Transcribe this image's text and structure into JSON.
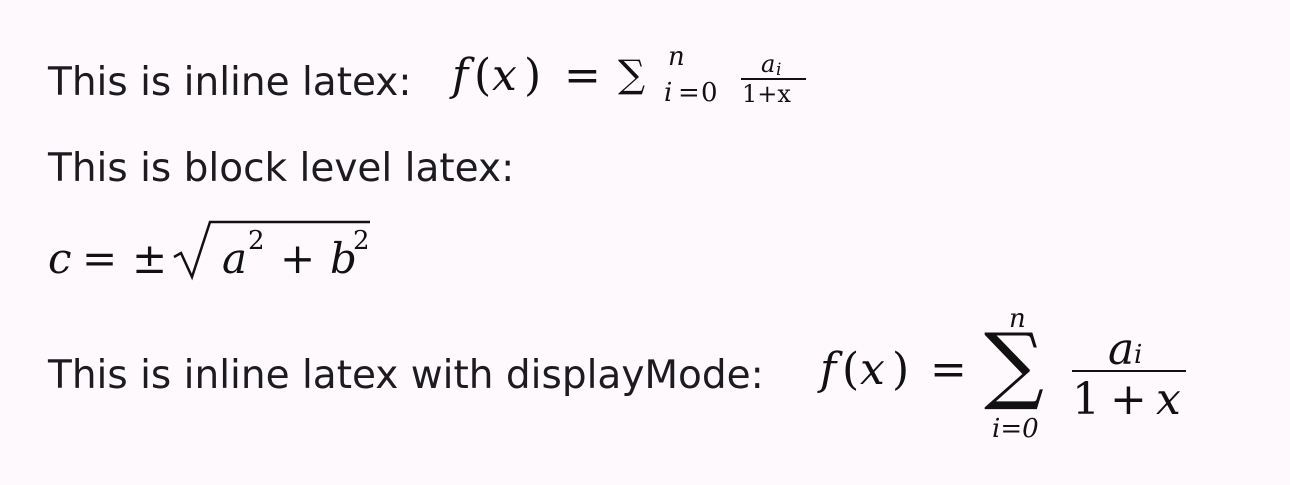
{
  "lines": {
    "inline_label": "This is inline latex:",
    "block_label": "This is block level latex:",
    "display_label": "This is inline latex with displayMode:"
  },
  "inline_math": {
    "f": "f",
    "lparen": "(",
    "x": "x",
    "rparen": ")",
    "eq": "=",
    "sum": "∑",
    "sup": "n",
    "sub_i": "i",
    "sub_eq": "=",
    "sub_0": "0",
    "num_a": "a",
    "num_i": "i",
    "den": "1+x"
  },
  "block_math": {
    "c": "c",
    "eq": "=",
    "pm": "±",
    "a": "a",
    "a_exp": "2",
    "plus": "+",
    "b": "b",
    "b_exp": "2"
  },
  "display_math": {
    "f": "f",
    "lparen": "(",
    "x": "x",
    "rparen": ")",
    "eq": "=",
    "sum": "∑",
    "sup": "n",
    "sub": "i=0",
    "num_a": "a",
    "num_i": "i",
    "den_1": "1",
    "den_plus": "+",
    "den_x": "x"
  }
}
